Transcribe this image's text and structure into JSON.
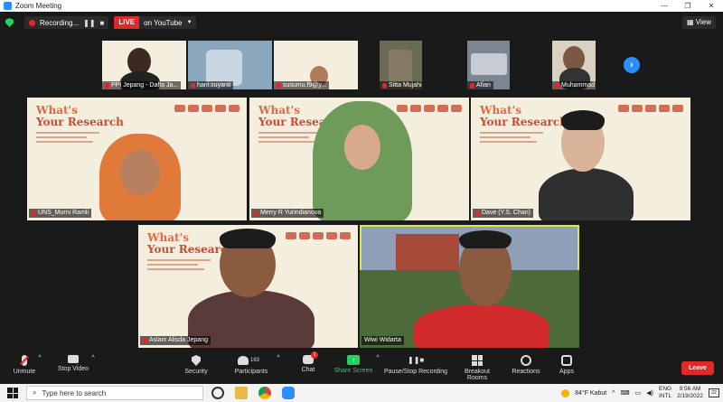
{
  "window": {
    "title": "Zoom Meeting"
  },
  "topbar": {
    "recording_label": "Recording...",
    "live_badge": "LIVE",
    "live_destination": "on YouTube",
    "view_label": "View"
  },
  "thumbnails": [
    {
      "name": "PPI Jepang - Daffa Ja..."
    },
    {
      "name": "hani.suyanti"
    },
    {
      "name": "susumu.f9@y..."
    },
    {
      "name": "Sitta Mujahid"
    },
    {
      "name": "Afian"
    },
    {
      "name": "Muhammad Imron"
    }
  ],
  "slide": {
    "line1": "What's",
    "line2": "Your Research"
  },
  "tiles": [
    {
      "name": "UNS_Murni Ramli"
    },
    {
      "name": "Merry R Yurindianova"
    },
    {
      "name": "Dave (Y.S. Chan)"
    },
    {
      "name": "Aslam Alisda Jepang"
    },
    {
      "name": "Wiwi Widarta"
    }
  ],
  "toolbar": {
    "unmute": "Unmute",
    "stop_video": "Stop Video",
    "security": "Security",
    "participants": "Participants",
    "participants_count": "163",
    "chat": "Chat",
    "chat_badge": "1",
    "share_screen": "Share Screen",
    "pause_recording": "Pause/Stop Recording",
    "breakout_rooms": "Breakout Rooms",
    "reactions": "Reactions",
    "apps": "Apps",
    "leave": "Leave"
  },
  "taskbar": {
    "search_placeholder": "Type here to search",
    "weather": "84°F Kabut",
    "lang": "ENG",
    "region": "INTL",
    "time": "9:56 AM",
    "date": "2/19/2022",
    "notif_count": "22"
  },
  "colors": {
    "accent": "#2d8cff",
    "live": "#e02828",
    "share": "#23d160",
    "active_speaker": "#d8e84a"
  }
}
